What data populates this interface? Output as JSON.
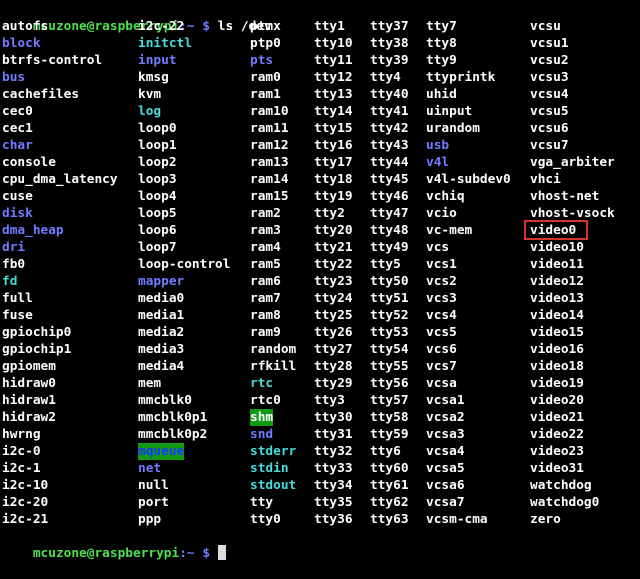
{
  "terminal": {
    "prompt_user": "mcuzone@raspberrypi",
    "prompt_path": ":~ $",
    "command": "ls /dev",
    "colors": {
      "background": "#000000",
      "file": "#ffffff",
      "directory": "#6f7cff",
      "symlink": "#44dcdc",
      "prompt": "#4ee04e",
      "sticky_dir_bg": "#129a12",
      "annotation_box": "#d9342b"
    },
    "columns": [
      [
        {
          "name": "autofs",
          "type": "file"
        },
        {
          "name": "block",
          "type": "dir"
        },
        {
          "name": "btrfs-control",
          "type": "file"
        },
        {
          "name": "bus",
          "type": "dir"
        },
        {
          "name": "cachefiles",
          "type": "file"
        },
        {
          "name": "cec0",
          "type": "file"
        },
        {
          "name": "cec1",
          "type": "file"
        },
        {
          "name": "char",
          "type": "dir"
        },
        {
          "name": "console",
          "type": "file"
        },
        {
          "name": "cpu_dma_latency",
          "type": "file"
        },
        {
          "name": "cuse",
          "type": "file"
        },
        {
          "name": "disk",
          "type": "dir"
        },
        {
          "name": "dma_heap",
          "type": "dir"
        },
        {
          "name": "dri",
          "type": "dir"
        },
        {
          "name": "fb0",
          "type": "file"
        },
        {
          "name": "fd",
          "type": "link"
        },
        {
          "name": "full",
          "type": "file"
        },
        {
          "name": "fuse",
          "type": "file"
        },
        {
          "name": "gpiochip0",
          "type": "file"
        },
        {
          "name": "gpiochip1",
          "type": "file"
        },
        {
          "name": "gpiomem",
          "type": "file"
        },
        {
          "name": "hidraw0",
          "type": "file"
        },
        {
          "name": "hidraw1",
          "type": "file"
        },
        {
          "name": "hidraw2",
          "type": "file"
        },
        {
          "name": "hwrng",
          "type": "file"
        },
        {
          "name": "i2c-0",
          "type": "file"
        },
        {
          "name": "i2c-1",
          "type": "file"
        },
        {
          "name": "i2c-10",
          "type": "file"
        },
        {
          "name": "i2c-20",
          "type": "file"
        },
        {
          "name": "i2c-21",
          "type": "file"
        }
      ],
      [
        {
          "name": "i2c-22",
          "type": "file"
        },
        {
          "name": "initctl",
          "type": "link"
        },
        {
          "name": "input",
          "type": "dir"
        },
        {
          "name": "kmsg",
          "type": "file"
        },
        {
          "name": "kvm",
          "type": "file"
        },
        {
          "name": "log",
          "type": "link"
        },
        {
          "name": "loop0",
          "type": "file"
        },
        {
          "name": "loop1",
          "type": "file"
        },
        {
          "name": "loop2",
          "type": "file"
        },
        {
          "name": "loop3",
          "type": "file"
        },
        {
          "name": "loop4",
          "type": "file"
        },
        {
          "name": "loop5",
          "type": "file"
        },
        {
          "name": "loop6",
          "type": "file"
        },
        {
          "name": "loop7",
          "type": "file"
        },
        {
          "name": "loop-control",
          "type": "file"
        },
        {
          "name": "mapper",
          "type": "dir"
        },
        {
          "name": "media0",
          "type": "file"
        },
        {
          "name": "media1",
          "type": "file"
        },
        {
          "name": "media2",
          "type": "file"
        },
        {
          "name": "media3",
          "type": "file"
        },
        {
          "name": "media4",
          "type": "file"
        },
        {
          "name": "mem",
          "type": "file"
        },
        {
          "name": "mmcblk0",
          "type": "file"
        },
        {
          "name": "mmcblk0p1",
          "type": "file"
        },
        {
          "name": "mmcblk0p2",
          "type": "file"
        },
        {
          "name": "mqueue",
          "type": "sticky"
        },
        {
          "name": "net",
          "type": "dir"
        },
        {
          "name": "null",
          "type": "file"
        },
        {
          "name": "port",
          "type": "file"
        },
        {
          "name": "ppp",
          "type": "file"
        }
      ],
      [
        {
          "name": "ptmx",
          "type": "file"
        },
        {
          "name": "ptp0",
          "type": "file"
        },
        {
          "name": "pts",
          "type": "dir"
        },
        {
          "name": "ram0",
          "type": "file"
        },
        {
          "name": "ram1",
          "type": "file"
        },
        {
          "name": "ram10",
          "type": "file"
        },
        {
          "name": "ram11",
          "type": "file"
        },
        {
          "name": "ram12",
          "type": "file"
        },
        {
          "name": "ram13",
          "type": "file"
        },
        {
          "name": "ram14",
          "type": "file"
        },
        {
          "name": "ram15",
          "type": "file"
        },
        {
          "name": "ram2",
          "type": "file"
        },
        {
          "name": "ram3",
          "type": "file"
        },
        {
          "name": "ram4",
          "type": "file"
        },
        {
          "name": "ram5",
          "type": "file"
        },
        {
          "name": "ram6",
          "type": "file"
        },
        {
          "name": "ram7",
          "type": "file"
        },
        {
          "name": "ram8",
          "type": "file"
        },
        {
          "name": "ram9",
          "type": "file"
        },
        {
          "name": "random",
          "type": "file"
        },
        {
          "name": "rfkill",
          "type": "file"
        },
        {
          "name": "rtc",
          "type": "link"
        },
        {
          "name": "rtc0",
          "type": "file"
        },
        {
          "name": "shm",
          "type": "sticky-plain"
        },
        {
          "name": "snd",
          "type": "dir"
        },
        {
          "name": "stderr",
          "type": "link"
        },
        {
          "name": "stdin",
          "type": "link"
        },
        {
          "name": "stdout",
          "type": "link"
        },
        {
          "name": "tty",
          "type": "file"
        },
        {
          "name": "tty0",
          "type": "file"
        }
      ],
      [
        {
          "name": "tty1",
          "type": "file"
        },
        {
          "name": "tty10",
          "type": "file"
        },
        {
          "name": "tty11",
          "type": "file"
        },
        {
          "name": "tty12",
          "type": "file"
        },
        {
          "name": "tty13",
          "type": "file"
        },
        {
          "name": "tty14",
          "type": "file"
        },
        {
          "name": "tty15",
          "type": "file"
        },
        {
          "name": "tty16",
          "type": "file"
        },
        {
          "name": "tty17",
          "type": "file"
        },
        {
          "name": "tty18",
          "type": "file"
        },
        {
          "name": "tty19",
          "type": "file"
        },
        {
          "name": "tty2",
          "type": "file"
        },
        {
          "name": "tty20",
          "type": "file"
        },
        {
          "name": "tty21",
          "type": "file"
        },
        {
          "name": "tty22",
          "type": "file"
        },
        {
          "name": "tty23",
          "type": "file"
        },
        {
          "name": "tty24",
          "type": "file"
        },
        {
          "name": "tty25",
          "type": "file"
        },
        {
          "name": "tty26",
          "type": "file"
        },
        {
          "name": "tty27",
          "type": "file"
        },
        {
          "name": "tty28",
          "type": "file"
        },
        {
          "name": "tty29",
          "type": "file"
        },
        {
          "name": "tty3",
          "type": "file"
        },
        {
          "name": "tty30",
          "type": "file"
        },
        {
          "name": "tty31",
          "type": "file"
        },
        {
          "name": "tty32",
          "type": "file"
        },
        {
          "name": "tty33",
          "type": "file"
        },
        {
          "name": "tty34",
          "type": "file"
        },
        {
          "name": "tty35",
          "type": "file"
        },
        {
          "name": "tty36",
          "type": "file"
        }
      ],
      [
        {
          "name": "tty37",
          "type": "file"
        },
        {
          "name": "tty38",
          "type": "file"
        },
        {
          "name": "tty39",
          "type": "file"
        },
        {
          "name": "tty4",
          "type": "file"
        },
        {
          "name": "tty40",
          "type": "file"
        },
        {
          "name": "tty41",
          "type": "file"
        },
        {
          "name": "tty42",
          "type": "file"
        },
        {
          "name": "tty43",
          "type": "file"
        },
        {
          "name": "tty44",
          "type": "file"
        },
        {
          "name": "tty45",
          "type": "file"
        },
        {
          "name": "tty46",
          "type": "file"
        },
        {
          "name": "tty47",
          "type": "file"
        },
        {
          "name": "tty48",
          "type": "file"
        },
        {
          "name": "tty49",
          "type": "file"
        },
        {
          "name": "tty5",
          "type": "file"
        },
        {
          "name": "tty50",
          "type": "file"
        },
        {
          "name": "tty51",
          "type": "file"
        },
        {
          "name": "tty52",
          "type": "file"
        },
        {
          "name": "tty53",
          "type": "file"
        },
        {
          "name": "tty54",
          "type": "file"
        },
        {
          "name": "tty55",
          "type": "file"
        },
        {
          "name": "tty56",
          "type": "file"
        },
        {
          "name": "tty57",
          "type": "file"
        },
        {
          "name": "tty58",
          "type": "file"
        },
        {
          "name": "tty59",
          "type": "file"
        },
        {
          "name": "tty6",
          "type": "file"
        },
        {
          "name": "tty60",
          "type": "file"
        },
        {
          "name": "tty61",
          "type": "file"
        },
        {
          "name": "tty62",
          "type": "file"
        },
        {
          "name": "tty63",
          "type": "file"
        }
      ],
      [
        {
          "name": "tty7",
          "type": "file"
        },
        {
          "name": "tty8",
          "type": "file"
        },
        {
          "name": "tty9",
          "type": "file"
        },
        {
          "name": "ttyprintk",
          "type": "file"
        },
        {
          "name": "uhid",
          "type": "file"
        },
        {
          "name": "uinput",
          "type": "file"
        },
        {
          "name": "urandom",
          "type": "file"
        },
        {
          "name": "usb",
          "type": "dir"
        },
        {
          "name": "v4l",
          "type": "dir"
        },
        {
          "name": "v4l-subdev0",
          "type": "file"
        },
        {
          "name": "vchiq",
          "type": "file"
        },
        {
          "name": "vcio",
          "type": "file"
        },
        {
          "name": "vc-mem",
          "type": "file"
        },
        {
          "name": "vcs",
          "type": "file"
        },
        {
          "name": "vcs1",
          "type": "file"
        },
        {
          "name": "vcs2",
          "type": "file"
        },
        {
          "name": "vcs3",
          "type": "file"
        },
        {
          "name": "vcs4",
          "type": "file"
        },
        {
          "name": "vcs5",
          "type": "file"
        },
        {
          "name": "vcs6",
          "type": "file"
        },
        {
          "name": "vcs7",
          "type": "file"
        },
        {
          "name": "vcsa",
          "type": "file"
        },
        {
          "name": "vcsa1",
          "type": "file"
        },
        {
          "name": "vcsa2",
          "type": "file"
        },
        {
          "name": "vcsa3",
          "type": "file"
        },
        {
          "name": "vcsa4",
          "type": "file"
        },
        {
          "name": "vcsa5",
          "type": "file"
        },
        {
          "name": "vcsa6",
          "type": "file"
        },
        {
          "name": "vcsa7",
          "type": "file"
        },
        {
          "name": "vcsm-cma",
          "type": "file"
        }
      ],
      [
        {
          "name": "vcsu",
          "type": "file"
        },
        {
          "name": "vcsu1",
          "type": "file"
        },
        {
          "name": "vcsu2",
          "type": "file"
        },
        {
          "name": "vcsu3",
          "type": "file"
        },
        {
          "name": "vcsu4",
          "type": "file"
        },
        {
          "name": "vcsu5",
          "type": "file"
        },
        {
          "name": "vcsu6",
          "type": "file"
        },
        {
          "name": "vcsu7",
          "type": "file"
        },
        {
          "name": "vga_arbiter",
          "type": "file"
        },
        {
          "name": "vhci",
          "type": "file"
        },
        {
          "name": "vhost-net",
          "type": "file"
        },
        {
          "name": "vhost-vsock",
          "type": "file"
        },
        {
          "name": "video0",
          "type": "file",
          "annotated": true
        },
        {
          "name": "video10",
          "type": "file"
        },
        {
          "name": "video11",
          "type": "file"
        },
        {
          "name": "video12",
          "type": "file"
        },
        {
          "name": "video13",
          "type": "file"
        },
        {
          "name": "video14",
          "type": "file"
        },
        {
          "name": "video15",
          "type": "file"
        },
        {
          "name": "video16",
          "type": "file"
        },
        {
          "name": "video18",
          "type": "file"
        },
        {
          "name": "video19",
          "type": "file"
        },
        {
          "name": "video20",
          "type": "file"
        },
        {
          "name": "video21",
          "type": "file"
        },
        {
          "name": "video22",
          "type": "file"
        },
        {
          "name": "video23",
          "type": "file"
        },
        {
          "name": "video31",
          "type": "file"
        },
        {
          "name": "watchdog",
          "type": "file"
        },
        {
          "name": "watchdog0",
          "type": "file"
        },
        {
          "name": "zero",
          "type": "file"
        }
      ]
    ]
  }
}
